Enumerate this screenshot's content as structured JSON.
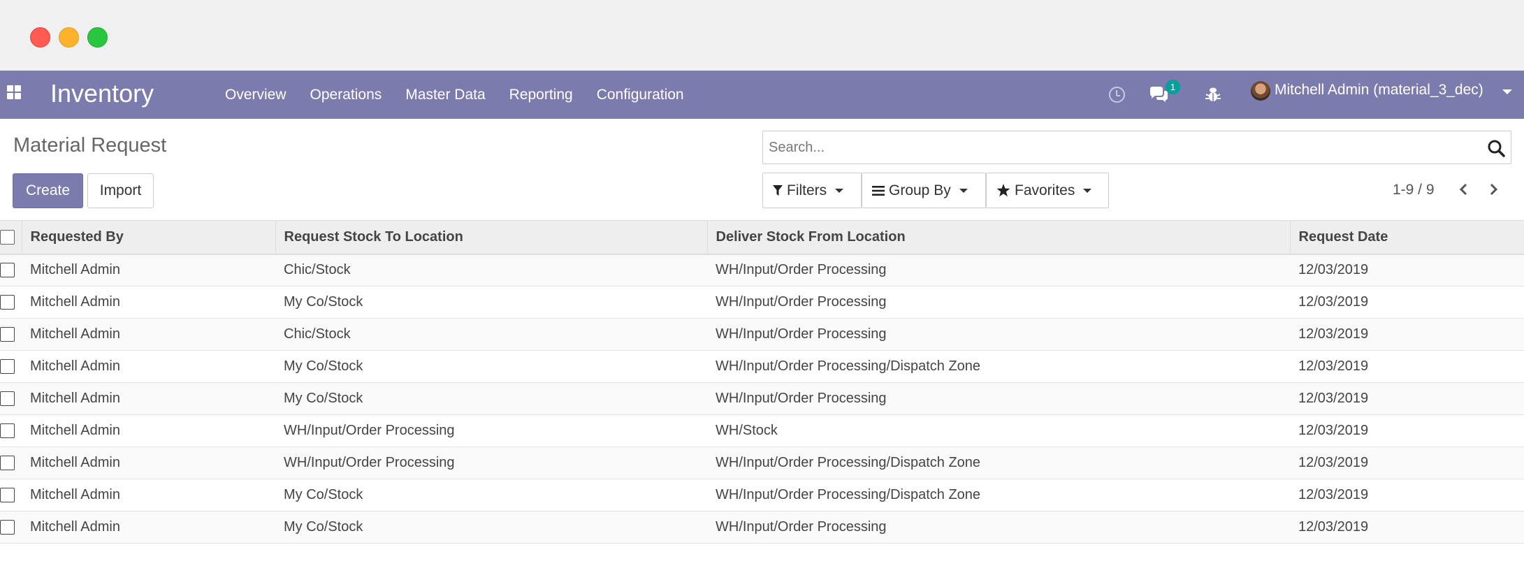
{
  "app": {
    "brand": "Inventory",
    "menu": [
      "Overview",
      "Operations",
      "Master Data",
      "Reporting",
      "Configuration"
    ],
    "message_count": "1",
    "user": "Mitchell Admin (material_3_dec)"
  },
  "page": {
    "title": "Material Request",
    "create_label": "Create",
    "import_label": "Import"
  },
  "search": {
    "placeholder": "Search...",
    "filters_label": "Filters",
    "groupby_label": "Group By",
    "favorites_label": "Favorites"
  },
  "pager": {
    "text": "1-9 / 9"
  },
  "table": {
    "columns": [
      "Requested By",
      "Request Stock To Location",
      "Deliver Stock From Location",
      "Request Date"
    ],
    "rows": [
      [
        "Mitchell Admin",
        "Chic/Stock",
        "WH/Input/Order Processing",
        "12/03/2019"
      ],
      [
        "Mitchell Admin",
        "My Co/Stock",
        "WH/Input/Order Processing",
        "12/03/2019"
      ],
      [
        "Mitchell Admin",
        "Chic/Stock",
        "WH/Input/Order Processing",
        "12/03/2019"
      ],
      [
        "Mitchell Admin",
        "My Co/Stock",
        "WH/Input/Order Processing/Dispatch Zone",
        "12/03/2019"
      ],
      [
        "Mitchell Admin",
        "My Co/Stock",
        "WH/Input/Order Processing",
        "12/03/2019"
      ],
      [
        "Mitchell Admin",
        "WH/Input/Order Processing",
        "WH/Stock",
        "12/03/2019"
      ],
      [
        "Mitchell Admin",
        "WH/Input/Order Processing",
        "WH/Input/Order Processing/Dispatch Zone",
        "12/03/2019"
      ],
      [
        "Mitchell Admin",
        "My Co/Stock",
        "WH/Input/Order Processing/Dispatch Zone",
        "12/03/2019"
      ],
      [
        "Mitchell Admin",
        "My Co/Stock",
        "WH/Input/Order Processing",
        "12/03/2019"
      ]
    ]
  },
  "colors": {
    "navbar": "#7c7bad",
    "primary_button": "#7c7bad",
    "badge": "#00a09d"
  },
  "icons": {
    "apps": "apps-grid-icon",
    "activity": "clock-icon",
    "messages": "chat-icon",
    "debug": "bug-icon",
    "search": "search-icon",
    "filters": "filter-icon",
    "groupby": "list-icon",
    "favorites": "star-icon"
  }
}
